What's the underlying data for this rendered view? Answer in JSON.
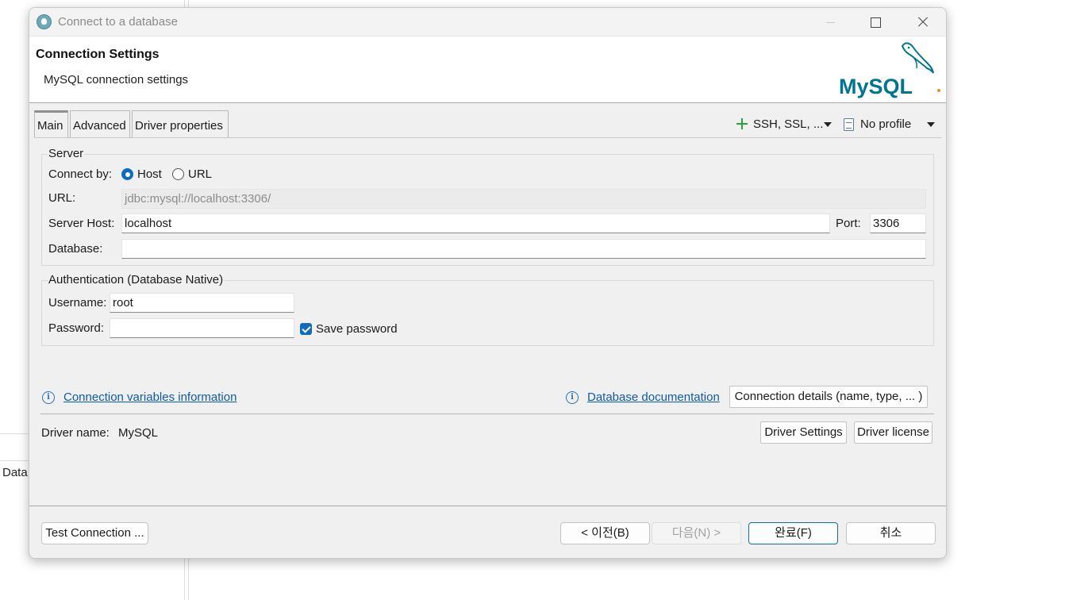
{
  "background": {
    "left_text": "Data"
  },
  "window": {
    "title": "Connect to a database",
    "controls": {
      "minimize": "minimize",
      "maximize": "maximize",
      "close": "close"
    }
  },
  "header": {
    "title": "Connection Settings",
    "subtitle": "MySQL connection settings",
    "logo_text": "MySQL"
  },
  "tabs": [
    {
      "label": "Main",
      "active": true
    },
    {
      "label": "Advanced",
      "active": false
    },
    {
      "label": "Driver properties",
      "active": false
    }
  ],
  "toolbar": {
    "network_label": "SSH, SSL, ...",
    "profile_label": "No profile"
  },
  "server": {
    "group_label": "Server",
    "connect_by_label": "Connect by:",
    "host_option": "Host",
    "url_option": "URL",
    "connect_by_selected": "Host",
    "url_label": "URL:",
    "url_value": "jdbc:mysql://localhost:3306/",
    "host_label": "Server Host:",
    "host_value": "localhost",
    "port_label": "Port:",
    "port_value": "3306",
    "database_label": "Database:",
    "database_value": ""
  },
  "auth": {
    "group_label": "Authentication (Database Native)",
    "username_label": "Username:",
    "username_value": "root",
    "password_label": "Password:",
    "password_value": "",
    "save_password_label": "Save password",
    "save_password_checked": true
  },
  "links": {
    "connection_variables": "Connection variables information",
    "database_documentation": "Database documentation",
    "connection_details_button": "Connection details (name, type, ... )"
  },
  "driver": {
    "name_label": "Driver name:",
    "name_value": "MySQL",
    "settings_button": "Driver Settings",
    "license_button": "Driver license"
  },
  "footer": {
    "test_connection": "Test Connection ...",
    "back": "< 이전(B)",
    "next": "다음(N) >",
    "finish": "완료(F)",
    "cancel": "취소"
  },
  "colors": {
    "accent": "#0f6cbd",
    "link": "#0b5cad",
    "mysql_blue": "#00758f",
    "mysql_orange": "#f29111"
  }
}
